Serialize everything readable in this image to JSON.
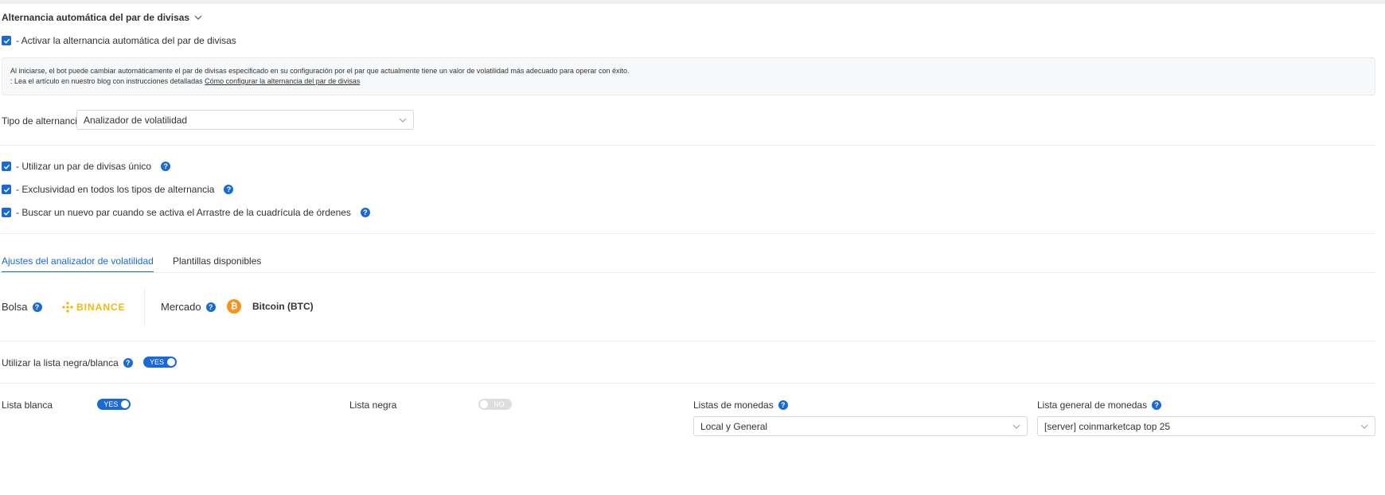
{
  "section": {
    "title": "Alternancia automática del par de divisas"
  },
  "auto_toggle": {
    "label": "- Activar la alternancia automática del par de divisas"
  },
  "info": {
    "line1": "Al iniciarse, el bot puede cambiar automáticamente el par de divisas especificado en su configuración por el par que actualmente tiene un valor de volatilidad más adecuado para operar con éxito.",
    "line2_prefix": ": Lea el artículo en nuestro blog con instrucciones detalladas ",
    "line2_link": "Cómo configurar la alternancia del par de divisas"
  },
  "alternation_type": {
    "label": "Tipo de alternancia",
    "value": "Analizador de volatilidad"
  },
  "options": [
    {
      "label": "- Utilizar un par de divisas único"
    },
    {
      "label": "- Exclusividad en todos los tipos de alternancia"
    },
    {
      "label": "- Buscar un nuevo par cuando se activa el Arrastre de la cuadrícula de órdenes"
    }
  ],
  "tabs": [
    {
      "label": "Ajustes del analizador de volatilidad"
    },
    {
      "label": "Plantillas disponibles"
    }
  ],
  "exchange": {
    "label": "Bolsa",
    "logo_text": "BINANCE"
  },
  "market": {
    "label": "Mercado",
    "value": "Bitcoin (BTC)",
    "coin_symbol": "₿"
  },
  "blackwhite": {
    "label": "Utilizar la lista negra/blanca",
    "toggle": "YES"
  },
  "whitelist": {
    "label": "Lista blanca",
    "toggle": "YES"
  },
  "blacklist": {
    "label": "Lista negra",
    "toggle": "NO"
  },
  "coin_lists": {
    "label": "Listas de monedas",
    "value": "Local y General"
  },
  "general_list": {
    "label": "Lista general de monedas",
    "value": "[server] coinmarketcap top 25"
  },
  "colors": {
    "accent": "#1a6ad6",
    "binance": "#f0b90b",
    "bitcoin": "#f7931a"
  }
}
